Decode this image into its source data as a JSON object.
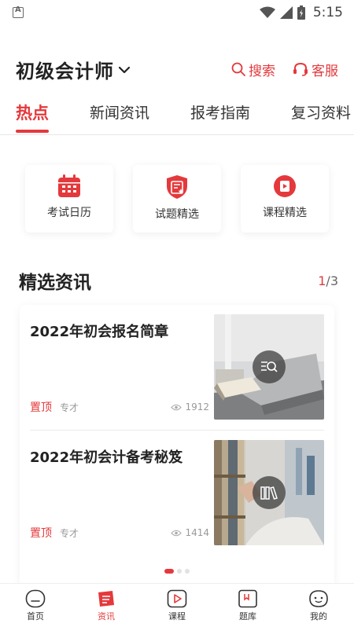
{
  "status_bar": {
    "time": "5:15"
  },
  "header": {
    "title": "初级会计师",
    "search_label": "搜索",
    "service_label": "客服"
  },
  "tabs": [
    {
      "label": "热点",
      "active": true
    },
    {
      "label": "新闻资讯",
      "active": false
    },
    {
      "label": "报考指南",
      "active": false
    },
    {
      "label": "复习资料",
      "active": false
    }
  ],
  "quick_links": [
    {
      "label": "考试日历",
      "icon": "calendar-icon"
    },
    {
      "label": "试题精选",
      "icon": "shield-star-icon"
    },
    {
      "label": "课程精选",
      "icon": "play-video-icon"
    }
  ],
  "section": {
    "title": "精选资讯",
    "page_current": "1",
    "page_total": "/3"
  },
  "news": [
    {
      "title": "2022年初会报名简章",
      "tag": "置顶",
      "source": "专才",
      "views": "1912",
      "thumb_icon": "search-list-icon"
    },
    {
      "title": "2022年初会计备考秘笈",
      "tag": "置顶",
      "source": "专才",
      "views": "1414",
      "thumb_icon": "books-icon"
    }
  ],
  "bottom_nav": [
    {
      "label": "首页",
      "icon": "home-icon",
      "active": false
    },
    {
      "label": "资讯",
      "icon": "news-icon",
      "active": true
    },
    {
      "label": "课程",
      "icon": "course-play-icon",
      "active": false
    },
    {
      "label": "题库",
      "icon": "question-bank-icon",
      "active": false
    },
    {
      "label": "我的",
      "icon": "profile-icon",
      "active": false
    }
  ],
  "colors": {
    "accent": "#e4393c"
  }
}
